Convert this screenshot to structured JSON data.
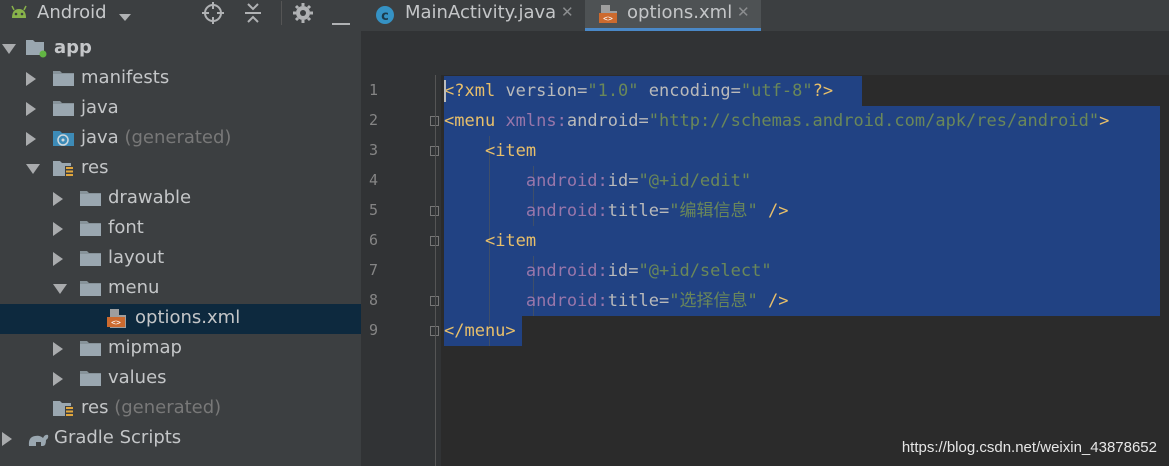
{
  "project_panel": {
    "title": "Android",
    "tree": [
      {
        "label": "app",
        "suffix": "",
        "indent": 0,
        "expanded": true,
        "icon": "app-module-icon",
        "bold": true
      },
      {
        "label": "manifests",
        "suffix": "",
        "indent": 1,
        "expanded": false,
        "icon": "folder-icon"
      },
      {
        "label": "java",
        "suffix": "",
        "indent": 1,
        "expanded": false,
        "icon": "folder-icon"
      },
      {
        "label": "java",
        "suffix": " (generated)",
        "indent": 1,
        "expanded": false,
        "icon": "generated-folder-icon"
      },
      {
        "label": "res",
        "suffix": "",
        "indent": 1,
        "expanded": true,
        "icon": "res-folder-icon"
      },
      {
        "label": "drawable",
        "suffix": "",
        "indent": 2,
        "expanded": false,
        "icon": "folder-icon"
      },
      {
        "label": "font",
        "suffix": "",
        "indent": 2,
        "expanded": false,
        "icon": "folder-icon"
      },
      {
        "label": "layout",
        "suffix": "",
        "indent": 2,
        "expanded": false,
        "icon": "folder-icon"
      },
      {
        "label": "menu",
        "suffix": "",
        "indent": 2,
        "expanded": true,
        "icon": "folder-icon"
      },
      {
        "label": "options.xml",
        "suffix": "",
        "indent": 3,
        "leaf": true,
        "icon": "xml-file-icon",
        "selected": true
      },
      {
        "label": "mipmap",
        "suffix": "",
        "indent": 2,
        "expanded": false,
        "icon": "folder-icon"
      },
      {
        "label": "values",
        "suffix": "",
        "indent": 2,
        "expanded": false,
        "icon": "folder-icon"
      },
      {
        "label": "res",
        "suffix": " (generated)",
        "indent": 1,
        "leaf": true,
        "icon": "res-folder-icon"
      },
      {
        "label": "Gradle Scripts",
        "suffix": "",
        "indent": 0,
        "expanded": false,
        "icon": "gradle-icon"
      }
    ]
  },
  "tabs": [
    {
      "label": "MainActivity.java",
      "icon": "java-class-icon",
      "active": false
    },
    {
      "label": "options.xml",
      "icon": "xml-file-icon",
      "active": true
    }
  ],
  "editor": {
    "line_numbers": [
      "1",
      "2",
      "3",
      "4",
      "5",
      "6",
      "7",
      "8",
      "9"
    ],
    "code_lines": [
      "<?xml version=\"1.0\" encoding=\"utf-8\"?>",
      "<menu xmlns:android=\"http://schemas.android.com/apk/res/android\">",
      "    <item",
      "        android:id=\"@+id/edit\"",
      "        android:title=\"编辑信息\" />",
      "    <item",
      "        android:id=\"@+id/select\"",
      "        android:title=\"选择信息\" />",
      "</menu>"
    ]
  },
  "watermark": "https://blog.csdn.net/weixin_43878652",
  "colors": {
    "selection": "#214283",
    "accent": "#4a88c7",
    "tag": "#e8bf6a",
    "namespace": "#9876aa",
    "string": "#6a8759"
  }
}
